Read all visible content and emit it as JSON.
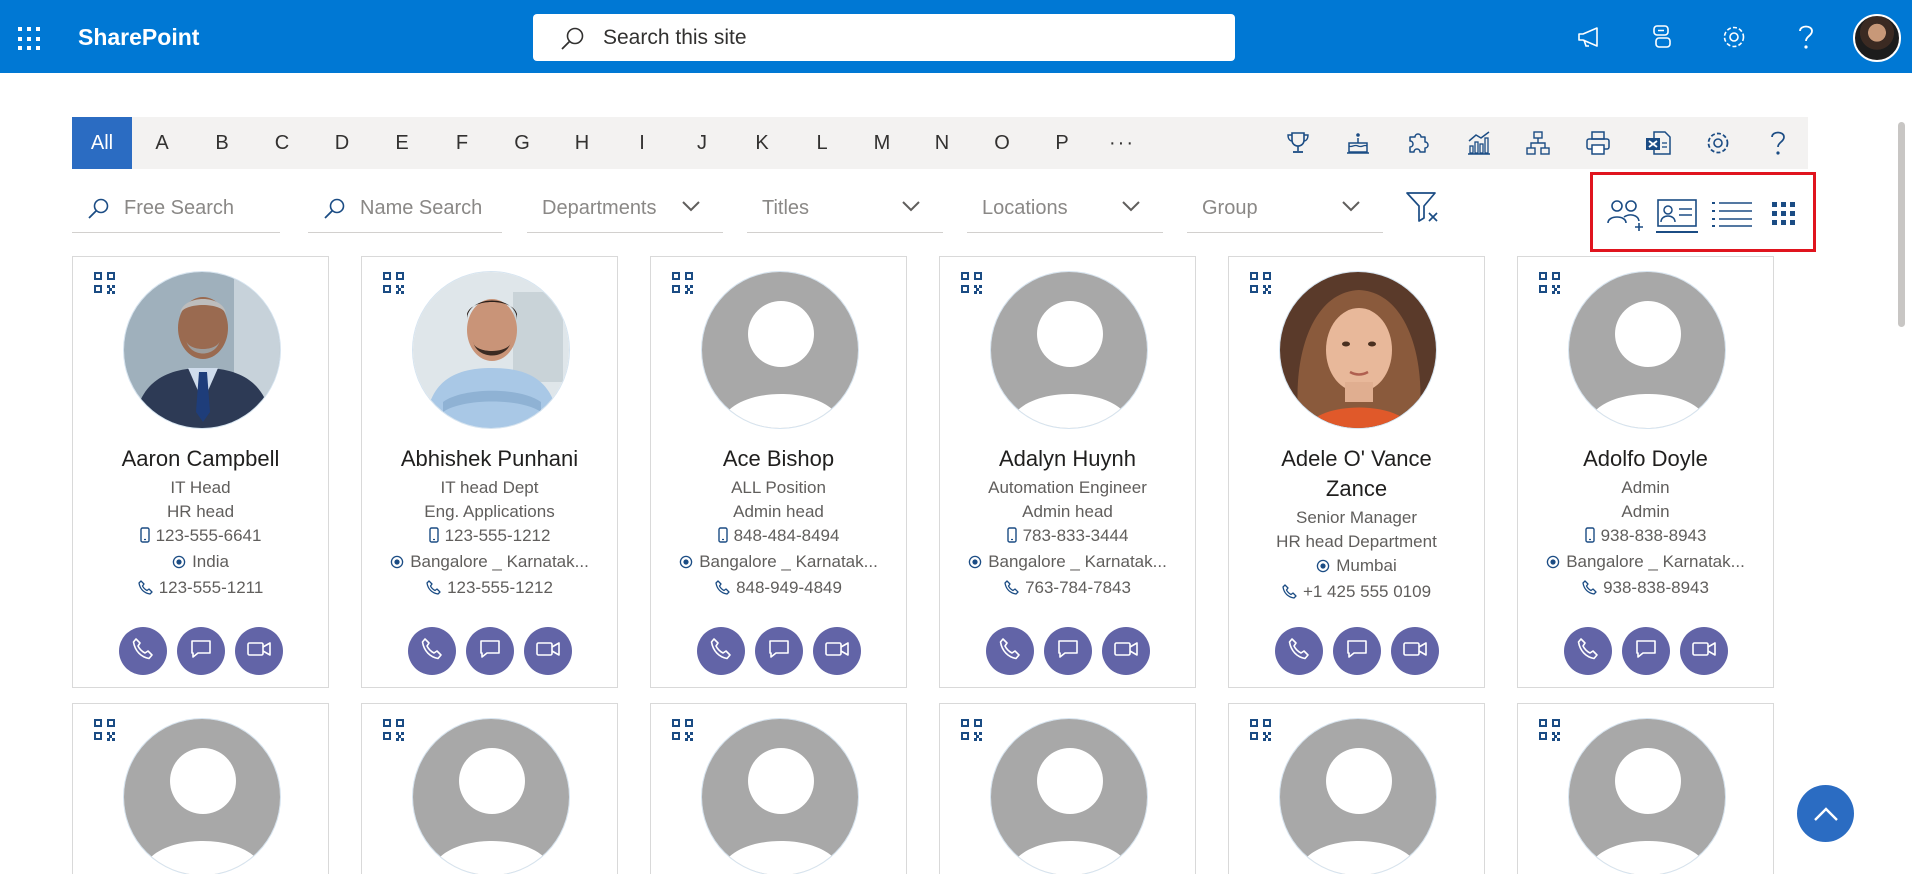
{
  "app": {
    "name": "SharePoint"
  },
  "search": {
    "placeholder": "Search this site"
  },
  "top_icons": [
    "megaphone-icon",
    "chat-switch-icon",
    "settings-gear-icon",
    "help-icon"
  ],
  "alphabet": [
    "All",
    "A",
    "B",
    "C",
    "D",
    "E",
    "F",
    "G",
    "H",
    "I",
    "J",
    "K",
    "L",
    "M",
    "N",
    "O",
    "P"
  ],
  "alphabet_more": "···",
  "active_letter": "All",
  "tools": [
    "trophy-icon",
    "birthday-cake-icon",
    "puzzle-icon",
    "chart-icon",
    "org-chart-icon",
    "print-icon",
    "excel-export-icon",
    "settings-icon",
    "help-icon"
  ],
  "filters": {
    "free_search": "Free Search",
    "name_search": "Name Search",
    "departments": "Departments",
    "titles": "Titles",
    "locations": "Locations",
    "group": "Group"
  },
  "views": [
    "add-people-view-icon",
    "card-view-icon",
    "list-view-icon",
    "grid-view-icon"
  ],
  "selected_view": "card-view-icon",
  "colors": {
    "brand": "#0078d4",
    "accent": "#2b6cc2",
    "action": "#6264a7",
    "highlight": "#e0141e"
  },
  "cards": [
    {
      "name": "Aaron Campbell",
      "title": "IT Head",
      "department": "HR head",
      "mobile": "123-555-6641",
      "location": "India",
      "phone": "123-555-1211",
      "photo": "man-suit"
    },
    {
      "name": "Abhishek Punhani",
      "title": "IT head Dept",
      "department": "Eng. Applications",
      "mobile": "123-555-1212",
      "location": "Bangalore _ Karnatak...",
      "phone": "123-555-1212",
      "photo": "man-shirt"
    },
    {
      "name": "Ace Bishop",
      "title": "ALL Position",
      "department": "Admin head",
      "mobile": "848-484-8494",
      "location": "Bangalore _ Karnatak...",
      "phone": "848-949-4849",
      "photo": "placeholder"
    },
    {
      "name": "Adalyn Huynh",
      "title": "Automation Engineer",
      "department": "Admin head",
      "mobile": "783-833-3444",
      "location": "Bangalore _ Karnatak...",
      "phone": "763-784-7843",
      "photo": "placeholder"
    },
    {
      "name": "Adele O' Vance Zance",
      "title": "Senior Manager",
      "department": "HR head Department",
      "location": "Mumbai",
      "phone": "+1 425 555 0109",
      "photo": "woman"
    },
    {
      "name": "Adolfo Doyle",
      "title": "Admin",
      "department": "Admin",
      "mobile": "938-838-8943",
      "location": "Bangalore _ Karnatak...",
      "phone": "938-838-8943",
      "photo": "placeholder"
    }
  ]
}
